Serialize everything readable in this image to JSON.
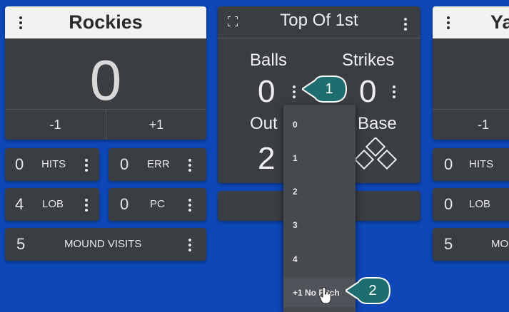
{
  "left_team": {
    "name": "Rockies",
    "score": "0",
    "minus_label": "-1",
    "plus_label": "+1",
    "stats": {
      "hits": {
        "value": "0",
        "label": "HITS"
      },
      "err": {
        "value": "0",
        "label": "ERR"
      },
      "lob": {
        "value": "4",
        "label": "LOB"
      },
      "pc": {
        "value": "0",
        "label": "PC"
      },
      "mound": {
        "value": "5",
        "label": "MOUND VISITS"
      }
    }
  },
  "inning_card": {
    "title": "Top Of 1st",
    "balls_label": "Balls",
    "balls_value": "0",
    "strikes_label": "Strikes",
    "strikes_value": "0",
    "outs_label": "Out",
    "outs_value": "2",
    "on_base_label": "n Base"
  },
  "right_team": {
    "name": "Ya",
    "minus_label": "-1",
    "stats": {
      "hits": {
        "value": "0",
        "label": "HITS"
      },
      "lob": {
        "value": "0",
        "label": "LOB"
      },
      "mound": {
        "value": "5",
        "label": "MO"
      }
    }
  },
  "balls_menu": {
    "items": [
      "0",
      "1",
      "2",
      "3",
      "4",
      "+1 No Pitch"
    ]
  },
  "callouts": {
    "one": "1",
    "two": "2"
  },
  "colors": {
    "background": "#0d47b8",
    "card": "#3a3d42",
    "callout": "#1e6e70"
  }
}
